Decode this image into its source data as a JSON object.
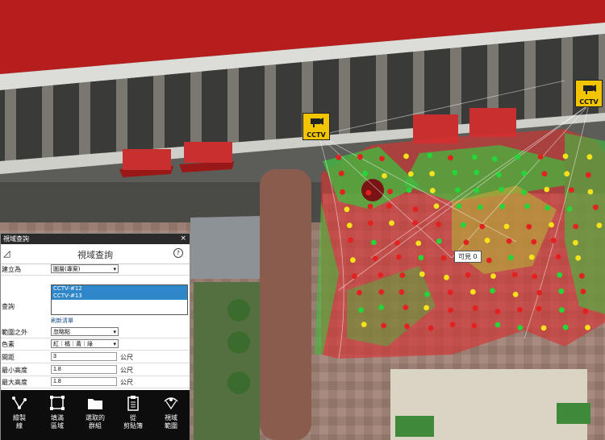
{
  "scene": {
    "camera_label": "CCTV",
    "tooltip": "可見 0",
    "visible_color": "#3fbf3f",
    "hidden_color": "#d83030"
  },
  "panel": {
    "window_title": "視域查詢",
    "header_title": "視域查詢",
    "create_as_label": "建立為",
    "create_as_value": "圖層(專案)",
    "query_label": "查詢",
    "query_items": [
      "CCTV-#12",
      "CCTV-#13"
    ],
    "refresh_link": "刷新清單",
    "out_of_range_label": "範圍之外",
    "out_of_range_value": "忽略點",
    "colors_label": "色素",
    "colors_value": "紅｜橘｜黃｜綠",
    "spacing_label": "間距",
    "spacing_value": "3",
    "min_height_label": "最小高度",
    "min_height_value": "1.8",
    "max_height_label": "最大高度",
    "max_height_value": "1.8",
    "unit": "公尺",
    "tools": [
      {
        "icon": "polyline-icon",
        "line1": "繪製",
        "line2": "線"
      },
      {
        "icon": "fill-region-icon",
        "line1": "填滿",
        "line2": "區域"
      },
      {
        "icon": "folder-icon",
        "line1": "選取的",
        "line2": "群組"
      },
      {
        "icon": "clipboard-icon",
        "line1": "從",
        "line2": "剪貼簿"
      },
      {
        "icon": "view-range-icon",
        "line1": "視域",
        "line2": "範圍"
      }
    ]
  }
}
